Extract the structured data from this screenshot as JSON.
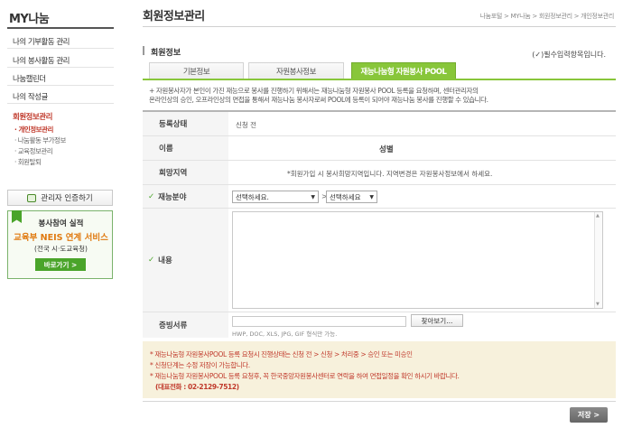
{
  "sidebar": {
    "title": "MY나눔",
    "menu": [
      {
        "label": "나의 기부활동 관리"
      },
      {
        "label": "나의 봉사활동 관리"
      },
      {
        "label": "나눔캘린더"
      },
      {
        "label": "나의 작성글"
      },
      {
        "label": "회원정보관리"
      }
    ],
    "submenu": [
      {
        "label": "· 개인정보관리"
      },
      {
        "label": "· 나눔활동 부가정보"
      },
      {
        "label": "· 교육정보관리"
      },
      {
        "label": "· 회원탈퇴"
      }
    ],
    "admin_button": "관리자 인증하기",
    "banner": {
      "line1": "봉사참여 실적",
      "line2": "교육부 NEIS 연계 서비스",
      "line3": "(전국 시·도교육청)",
      "button": "바로가기 >"
    }
  },
  "header": {
    "title": "회원정보관리",
    "breadcrumb": "나눔포털 > MY나눔 > 회원정보관리 > 개인정보관리"
  },
  "section": {
    "title": "회원정보",
    "required_note": "(✓)필수입력항목입니다."
  },
  "tabs": [
    {
      "label": "기본정보"
    },
    {
      "label": "자원봉사정보"
    },
    {
      "label": "재능나눔형 자원봉사 POOL"
    }
  ],
  "intro": {
    "line1": "+ 자원봉사자가 본인이 가진 재능으로 봉사를 진행하기 위해서는 재능나눔형 자원봉사 POOL 등록을 요청하며, 센터관리자의",
    "line2": "온라인상의 승인, 오프라인상의 면접을 통해서 재능나눔 봉사자로써 POOL에 등록이 되어야 재능나눔 봉사를 진행할 수 있습니다."
  },
  "form": {
    "status": {
      "label": "등록상태",
      "value": "신청 전"
    },
    "name": {
      "label": "이름",
      "gender_label": "성별"
    },
    "region": {
      "label": "희망지역",
      "value": "*회원가입 시 봉사희망지역입니다. 지역변경은 자원봉사정보에서 하세요."
    },
    "talent": {
      "label": "재능분야",
      "check": "✓",
      "select1": "선택하세요.",
      "separator": ">",
      "select2": "선택하세요"
    },
    "content": {
      "label": "내용",
      "check": "✓"
    },
    "file": {
      "label": "증빙서류",
      "button": "찾아보기...",
      "hint": "HWP, DOC, XLS, JPG, GIF 형식만 가능."
    }
  },
  "notices": [
    {
      "text": "* 재능나눔형 자원봉사POOL 등록 요청시 진행상태는 신청 전 > 신청 > 처리중 > 승인 또는 미승인"
    },
    {
      "text": "* 신청단계는 수정 저장이 가능합니다."
    },
    {
      "text": "* 재능나눔형 자원봉사POOL 등록 요청후, 꼭 한국중앙자원봉사센터로 연락을 하여 면접일정을 확인 하시기 바랍니다."
    },
    {
      "text": "(대표전화 : 02-2129-7512)"
    }
  ],
  "save_button": "저장 >"
}
